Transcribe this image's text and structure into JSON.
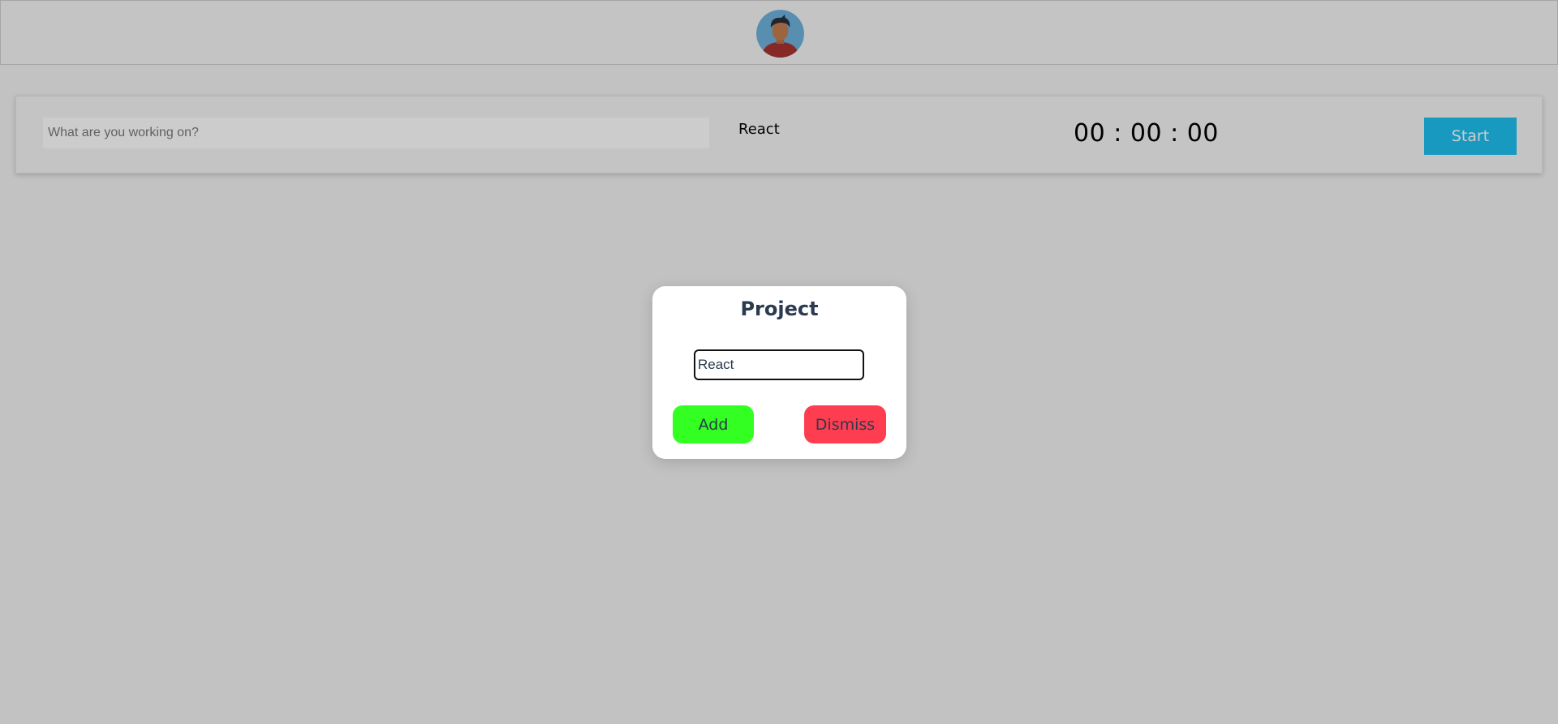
{
  "header": {
    "avatar_icon": "user-avatar-icon"
  },
  "timer_bar": {
    "task_placeholder": "What are you working on?",
    "task_value": "",
    "project": "React",
    "clock": "00 : 00 : 00",
    "start_label": "Start",
    "accent_color": "#1fc0f0"
  },
  "modal": {
    "title": "Project",
    "input_value": "React",
    "add_label": "Add",
    "dismiss_label": "Dismiss",
    "add_color": "#33ff22",
    "dismiss_color": "#ff3d50"
  }
}
